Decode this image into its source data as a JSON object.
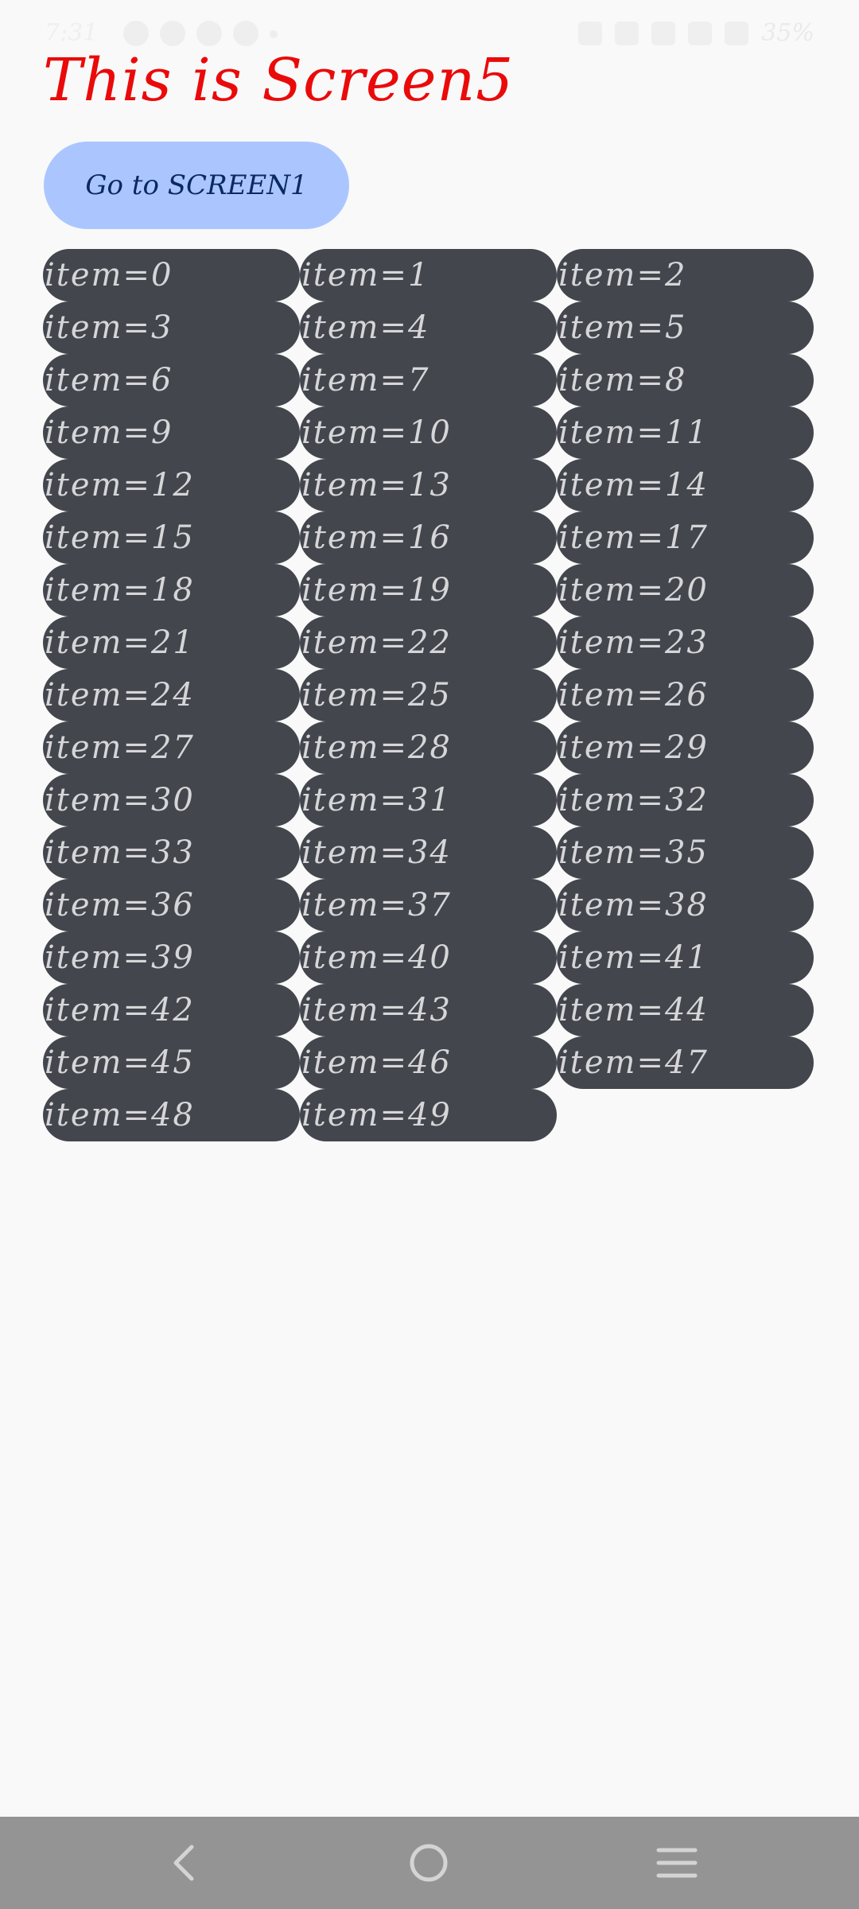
{
  "status_bar": {
    "time": "7:31",
    "battery": "35%",
    "notification_icons": [
      "snapchat-icon",
      "snapchat-icon",
      "snapchat-icon",
      "whatsapp-icon",
      "dot-icon"
    ],
    "system_icons": [
      "alarm-icon",
      "signal-icon",
      "wifi-icon",
      "cell-signal-icon",
      "battery-icon"
    ]
  },
  "screen": {
    "title": "This is Screen5",
    "title_color": "#ea0a0a"
  },
  "nav_button": {
    "label": "Go to SCREEN1",
    "background": "#abc6ff"
  },
  "grid": {
    "item_background": "#43464d",
    "items": [
      "item=0",
      "item=1",
      "item=2",
      "item=3",
      "item=4",
      "item=5",
      "item=6",
      "item=7",
      "item=8",
      "item=9",
      "item=10",
      "item=11",
      "item=12",
      "item=13",
      "item=14",
      "item=15",
      "item=16",
      "item=17",
      "item=18",
      "item=19",
      "item=20",
      "item=21",
      "item=22",
      "item=23",
      "item=24",
      "item=25",
      "item=26",
      "item=27",
      "item=28",
      "item=29",
      "item=30",
      "item=31",
      "item=32",
      "item=33",
      "item=34",
      "item=35",
      "item=36",
      "item=37",
      "item=38",
      "item=39",
      "item=40",
      "item=41",
      "item=42",
      "item=43",
      "item=44",
      "item=45",
      "item=46",
      "item=47",
      "item=48",
      "item=49"
    ]
  },
  "navigation_bar": {
    "buttons": [
      "back-icon",
      "home-icon",
      "recents-menu-icon"
    ]
  }
}
